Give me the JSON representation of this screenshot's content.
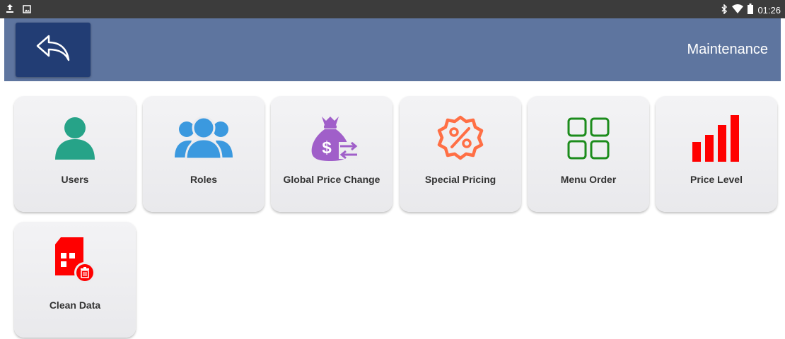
{
  "status_bar": {
    "time": "01:26",
    "left_icons": [
      "upload-icon",
      "image-icon"
    ],
    "right_icons": [
      "bluetooth-icon",
      "wifi-icon",
      "battery-icon"
    ]
  },
  "app_bar": {
    "title": "Maintenance",
    "back_icon": "back-arrow-icon",
    "color": "#5e759f",
    "back_button_color": "#223d74"
  },
  "tiles": [
    {
      "label": "Users",
      "icon": "user-icon",
      "color": "#26a388"
    },
    {
      "label": "Roles",
      "icon": "roles-icon",
      "color": "#3b99df"
    },
    {
      "label": "Global Price Change",
      "icon": "money-bag-exchange-icon",
      "color": "#a05fc9"
    },
    {
      "label": "Special Pricing",
      "icon": "percent-badge-icon",
      "color": "#ff6f45"
    },
    {
      "label": "Menu Order",
      "icon": "grid-icon",
      "color": "#1c8c1c"
    },
    {
      "label": "Price Level",
      "icon": "signal-bars-icon",
      "color": "#ff0000"
    },
    {
      "label": "Clean Data",
      "icon": "clean-data-icon",
      "color": "#ff0000"
    }
  ]
}
